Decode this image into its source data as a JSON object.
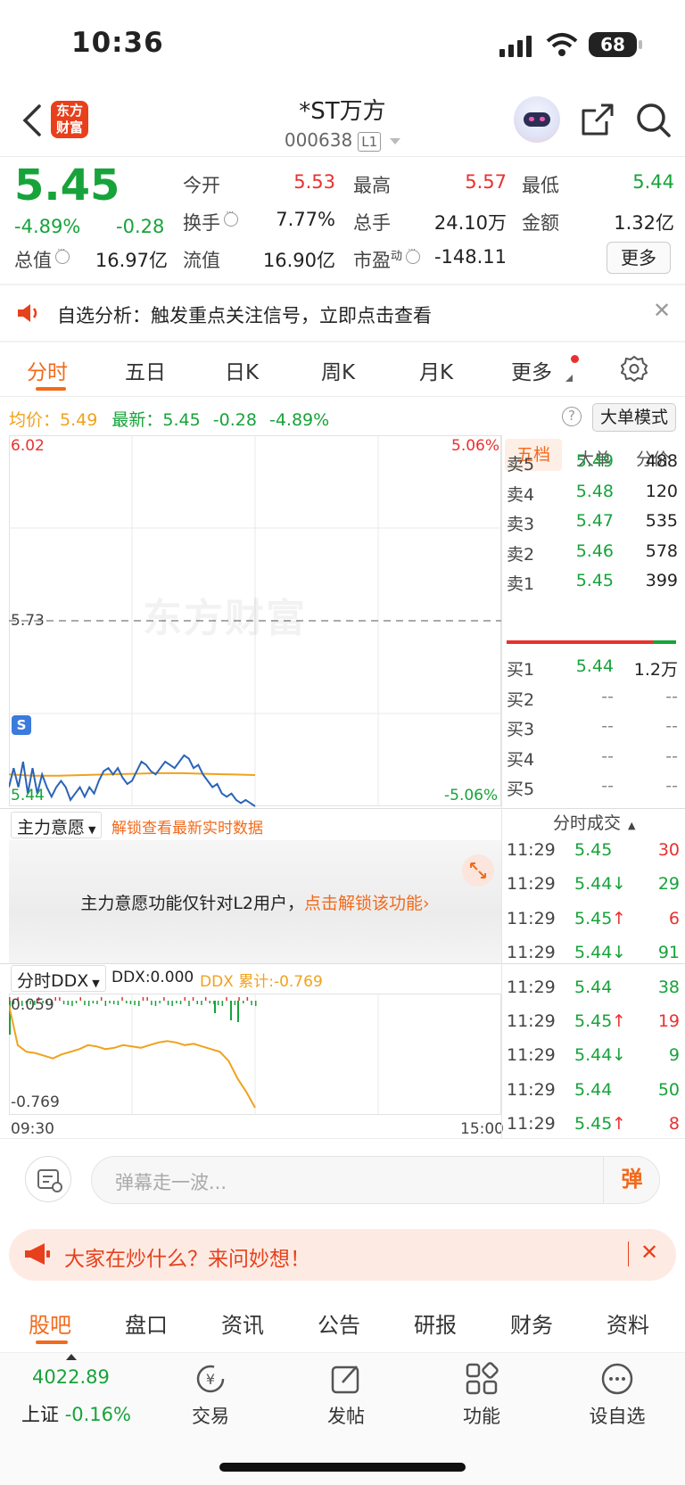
{
  "status": {
    "time": "10:36",
    "battery": "68"
  },
  "header": {
    "title": "*ST万方",
    "code": "000638",
    "level": "L1",
    "logo_text": "东方财富"
  },
  "quote": {
    "price": "5.45",
    "pct": "-4.89%",
    "chg": "-0.28",
    "open_lbl": "今开",
    "open": "5.53",
    "high_lbl": "最高",
    "high": "5.57",
    "low_lbl": "最低",
    "low": "5.44",
    "turnover_lbl": "换手",
    "turnover": "7.77%",
    "vol_lbl": "总手",
    "vol": "24.10万",
    "amt_lbl": "金额",
    "amt": "1.32亿",
    "mcap_lbl": "总值",
    "mcap": "16.97亿",
    "float_lbl": "流值",
    "float": "16.90亿",
    "pe_lbl": "市盈",
    "pe_sup": "动",
    "pe": "-148.11",
    "more": "更多"
  },
  "notice": {
    "text": "自选分析：触发重点关注信号，立即点击查看"
  },
  "tabs": [
    "分时",
    "五日",
    "日K",
    "周K",
    "月K",
    "更多"
  ],
  "chart_info": {
    "avg_lbl": "均价：",
    "avg": "5.49",
    "last_lbl": "最新：",
    "last": "5.45",
    "chg": "-0.28",
    "pct": "-4.89%",
    "big_mode": "大单模式"
  },
  "chart_labels": {
    "ymax": "6.02",
    "ymid": "5.73",
    "ymin": "5.44",
    "pmax": "5.06%",
    "pmin": "-5.06%",
    "s_marker": "S",
    "watermark": "东方财富",
    "t_start": "09:30",
    "t_end": "15:00"
  },
  "main_force": {
    "select": "主力意愿",
    "unlock": "解锁查看最新实时数据",
    "msg": "主力意愿功能仅针对L2用户，",
    "msg_link": "点击解锁该功能"
  },
  "ddx": {
    "select": "分时DDX",
    "ddx": "DDX:0.000",
    "ddx_sum": "DDX 累计:-0.769",
    "top": "0.059",
    "bottom": "-0.769"
  },
  "orderbook": {
    "tabs": [
      "五档",
      "大单",
      "分价"
    ],
    "sells": [
      {
        "l": "卖5",
        "p": "5.49",
        "v": "488"
      },
      {
        "l": "卖4",
        "p": "5.48",
        "v": "120"
      },
      {
        "l": "卖3",
        "p": "5.47",
        "v": "535"
      },
      {
        "l": "卖2",
        "p": "5.46",
        "v": "578"
      },
      {
        "l": "卖1",
        "p": "5.45",
        "v": "399"
      }
    ],
    "buys": [
      {
        "l": "买1",
        "p": "5.44",
        "v": "1.2万"
      },
      {
        "l": "买2",
        "p": "--",
        "v": "--"
      },
      {
        "l": "买3",
        "p": "--",
        "v": "--"
      },
      {
        "l": "买4",
        "p": "--",
        "v": "--"
      },
      {
        "l": "买5",
        "p": "--",
        "v": "--"
      }
    ]
  },
  "ticks": {
    "title": "分时成交",
    "rows": [
      {
        "t": "11:29",
        "p": "5.45",
        "d": "",
        "v": "30",
        "vc": "red"
      },
      {
        "t": "11:29",
        "p": "5.44",
        "d": "↓",
        "v": "29",
        "vc": "green"
      },
      {
        "t": "11:29",
        "p": "5.45",
        "d": "↑",
        "v": "6",
        "vc": "red"
      },
      {
        "t": "11:29",
        "p": "5.44",
        "d": "↓",
        "v": "91",
        "vc": "green"
      },
      {
        "t": "11:29",
        "p": "5.44",
        "d": "",
        "v": "38",
        "vc": "green"
      },
      {
        "t": "11:29",
        "p": "5.45",
        "d": "↑",
        "v": "19",
        "vc": "red"
      },
      {
        "t": "11:29",
        "p": "5.44",
        "d": "↓",
        "v": "9",
        "vc": "green"
      },
      {
        "t": "11:29",
        "p": "5.44",
        "d": "",
        "v": "50",
        "vc": "green"
      },
      {
        "t": "11:29",
        "p": "5.45",
        "d": "↑",
        "v": "8",
        "vc": "red"
      }
    ]
  },
  "danmu": {
    "placeholder": "弹幕走一波...",
    "send": "弹"
  },
  "promo": {
    "text": "大家在炒什么？来问妙想！"
  },
  "bottom_tabs": [
    "股吧",
    "盘口",
    "资讯",
    "公告",
    "研报",
    "财务",
    "资料"
  ],
  "nav": {
    "index_val": "4022.89",
    "index_name": "上证",
    "index_pct": "-0.16%",
    "trade": "交易",
    "post": "发帖",
    "func": "功能",
    "watch": "设自选"
  },
  "chart_data": {
    "type": "line",
    "title": "",
    "y_axis": {
      "min": 5.44,
      "max": 6.02,
      "ref": 5.73
    },
    "x_range": [
      "09:30",
      "15:00"
    ],
    "series": [
      {
        "values": [
          5.47,
          5.5,
          5.47,
          5.51,
          5.46,
          5.5,
          5.46,
          5.49,
          5.47,
          5.455,
          5.47,
          5.48,
          5.47,
          5.45,
          5.46,
          5.47,
          5.455,
          5.47,
          5.46,
          5.48,
          5.495,
          5.5,
          5.49,
          5.5,
          5.485,
          5.475,
          5.48,
          5.495,
          5.51,
          5.505,
          5.495,
          5.49,
          5.5,
          5.51,
          5.505,
          5.5,
          5.51,
          5.52,
          5.515,
          5.5,
          5.505,
          5.49,
          5.48,
          5.47,
          5.475,
          5.46,
          5.455,
          5.46,
          5.45,
          5.445,
          5.45,
          5.445,
          5.44
        ]
      },
      {
        "values": [
          5.49,
          5.488,
          5.488,
          5.489,
          5.49,
          5.491,
          5.492,
          5.492,
          5.491,
          5.49,
          5.489
        ]
      }
    ],
    "ddx_cumulative": {
      "range": [
        -0.769,
        0.059
      ],
      "values": [
        0.0,
        -0.3,
        -0.35,
        -0.36,
        -0.38,
        -0.4,
        -0.37,
        -0.35,
        -0.33,
        -0.3,
        -0.31,
        -0.33,
        -0.32,
        -0.3,
        -0.31,
        -0.32,
        -0.3,
        -0.28,
        -0.27,
        -0.28,
        -0.3,
        -0.29,
        -0.31,
        -0.33,
        -0.35,
        -0.42,
        -0.55,
        -0.65,
        -0.769
      ]
    }
  }
}
